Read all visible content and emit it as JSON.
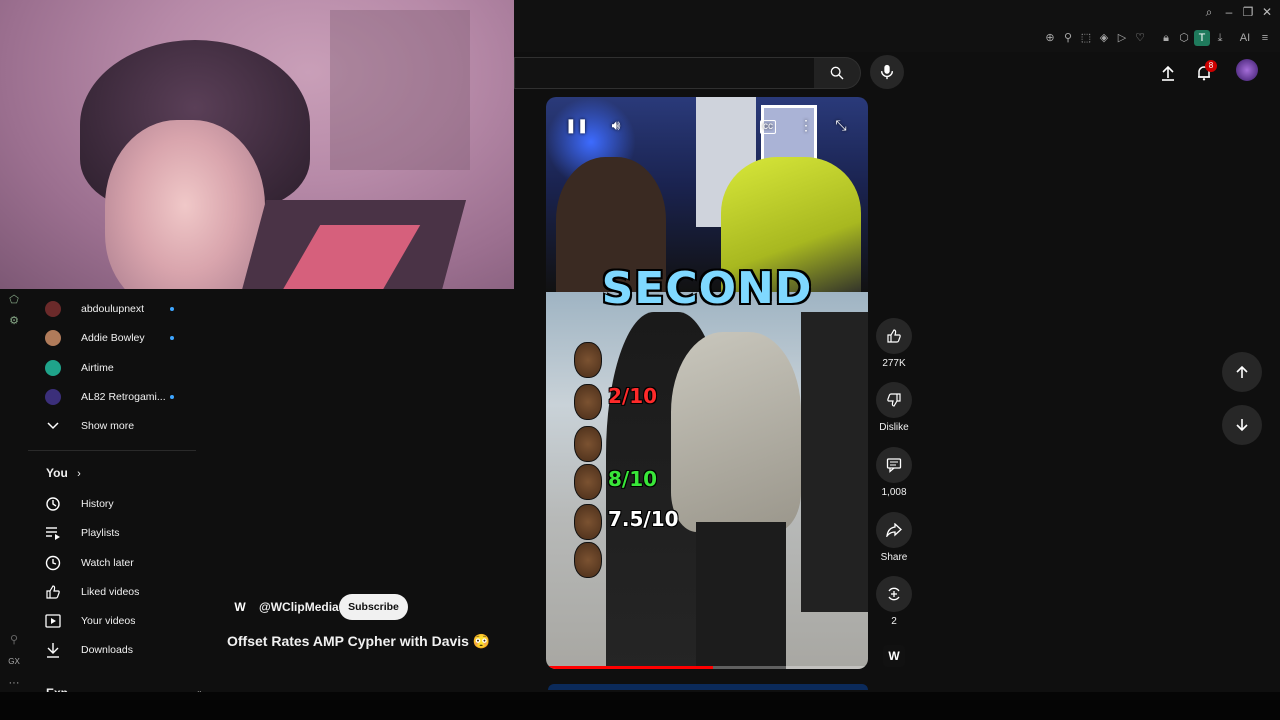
{
  "browser": {
    "window_controls": [
      "search",
      "minimize",
      "restore",
      "close"
    ],
    "extension_ai_label": "AI",
    "extension_t_label": "T"
  },
  "header": {
    "notification_count": "8"
  },
  "sidebar": {
    "subscriptions": [
      {
        "label": "abdoulupnext",
        "avatar_color": "#6b2a2a",
        "live": true
      },
      {
        "label": "Addie Bowley",
        "avatar_color": "#b07b5a",
        "live": true
      },
      {
        "label": "Airtime",
        "avatar_color": "#1fa38a",
        "live": false
      },
      {
        "label": "AL82 Retrogami...",
        "avatar_color": "#3b2f7a",
        "live": true
      }
    ],
    "show_more": "Show more",
    "you_section": "You",
    "you_items": [
      {
        "label": "History",
        "icon": "history-icon"
      },
      {
        "label": "Playlists",
        "icon": "playlists-icon"
      },
      {
        "label": "Watch later",
        "icon": "watch-later-icon"
      },
      {
        "label": "Liked videos",
        "icon": "liked-icon"
      },
      {
        "label": "Your videos",
        "icon": "your-videos-icon"
      },
      {
        "label": "Downloads",
        "icon": "downloads-icon"
      }
    ],
    "next_section_partial": "Exp"
  },
  "video": {
    "overlay_text": "SECOND",
    "ratings": [
      {
        "text": "2/10",
        "color": "#ff2a2a"
      },
      {
        "text": "8/10",
        "color": "#39e639"
      },
      {
        "text": "7.5/10",
        "color": "#ffffff"
      }
    ],
    "progress": 0.52,
    "controls": [
      "pause-icon",
      "volume-icon",
      "captions-icon",
      "more-icon",
      "expand-icon"
    ]
  },
  "actions": {
    "likes": "277K",
    "dislike": "Dislike",
    "comments": "1,008",
    "share": "Share",
    "remix": "2"
  },
  "channel": {
    "logo_text": "W",
    "handle": "@WClipMedia",
    "subscribe": "Subscribe"
  },
  "title": "Offset Rates AMP Cypher with Davis 😳",
  "rail": {
    "gx_label": "GX",
    "more_label": "···"
  },
  "colors": {
    "accent_blue": "#3ea6ff",
    "brand_red": "#ff0000",
    "overlay_text": "#7fd8ff"
  }
}
